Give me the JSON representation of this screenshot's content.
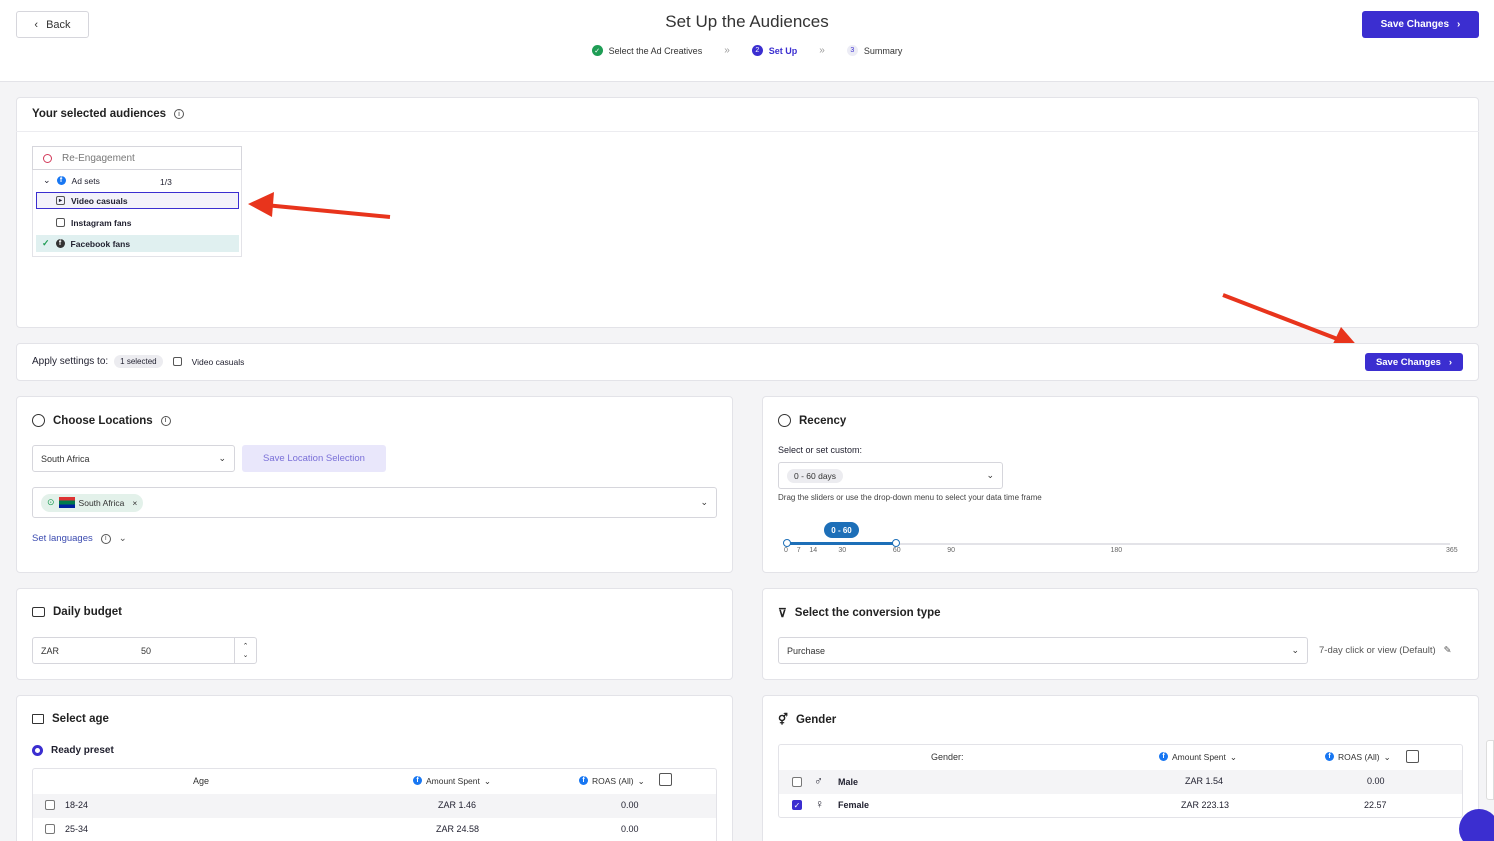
{
  "header": {
    "back_label": "Back",
    "title": "Set Up the Audiences",
    "steps": [
      {
        "num": "✓",
        "label": "Select the Ad Creatives",
        "state": "done"
      },
      {
        "num": "2",
        "label": "Set Up",
        "state": "active"
      },
      {
        "num": "3",
        "label": "Summary",
        "state": "pending"
      }
    ],
    "step_separator": "»",
    "save_label": "Save Changes"
  },
  "audiences": {
    "title": "Your selected audiences",
    "root_label": "Re-Engagement",
    "adsets_label": "Ad sets",
    "adsets_count": "1/3",
    "items": [
      "Video casuals",
      "Instagram fans",
      "Facebook fans"
    ]
  },
  "apply": {
    "label": "Apply settings to:",
    "badge": "1 selected",
    "target": "Video casuals",
    "save_label": "Save Changes"
  },
  "locations": {
    "title": "Choose Locations",
    "country_value": "South Africa",
    "save_selection_label": "Save Location Selection",
    "chip_label": "South Africa",
    "languages_label": "Set languages"
  },
  "recency": {
    "title": "Recency",
    "select_label": "Select or set custom:",
    "select_value": "0 - 60 days",
    "hint": "Drag the sliders or use the drop-down menu to select your data time frame",
    "range_label": "0 - 60",
    "range_min": 0,
    "range_max": 60,
    "ticks": [
      "0",
      "7",
      "14",
      "30",
      "60",
      "90",
      "180",
      "365"
    ]
  },
  "budget": {
    "title": "Daily budget",
    "currency": "ZAR",
    "amount": "50"
  },
  "conversion": {
    "title": "Select the conversion type",
    "value": "Purchase",
    "window_label": "7-day click or view (Default)"
  },
  "age": {
    "title": "Select age",
    "preset_label": "Ready preset",
    "col_age": "Age",
    "col_spent": "Amount Spent",
    "col_roas": "ROAS (All)",
    "rows": [
      {
        "label": "18-24",
        "spent": "ZAR 1.46",
        "roas": "0.00"
      },
      {
        "label": "25-34",
        "spent": "ZAR 24.58",
        "roas": "0.00"
      }
    ]
  },
  "gender": {
    "title": "Gender",
    "col_gender": "Gender:",
    "col_spent": "Amount Spent",
    "col_roas": "ROAS (All)",
    "rows": [
      {
        "label": "Male",
        "spent": "ZAR 1.54",
        "roas": "0.00",
        "checked": false
      },
      {
        "label": "Female",
        "spent": "ZAR 223.13",
        "roas": "22.57",
        "checked": true
      }
    ]
  },
  "colors": {
    "accent": "#3b2ed0",
    "success": "#1f9d55",
    "annotation": "#e8341c",
    "slider": "#1d6fb8"
  }
}
